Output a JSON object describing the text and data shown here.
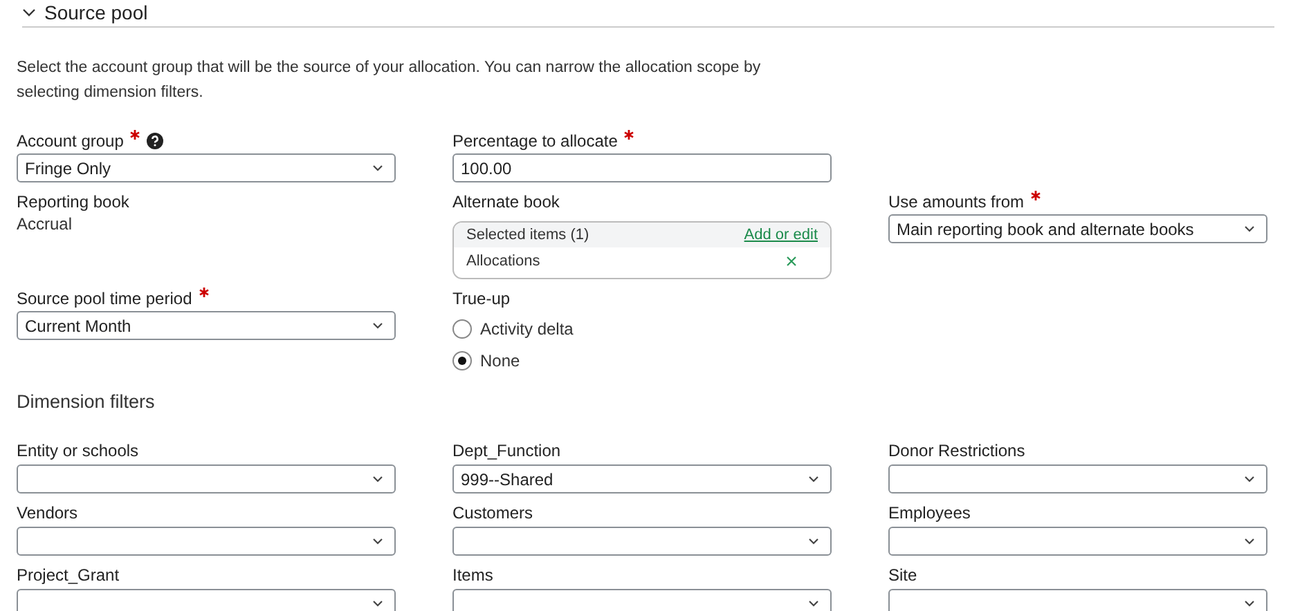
{
  "section": {
    "title": "Source pool",
    "expanded": true
  },
  "description": "Select the account group that will be the source of your allocation. You can narrow the allocation scope by selecting dimension filters.",
  "rows": [
    [
      {
        "kind": "select",
        "label": "Account group",
        "required": true,
        "help": true,
        "value": "Fringe Only"
      },
      {
        "kind": "text",
        "label": "Percentage to allocate",
        "required": true,
        "value": "100.00"
      }
    ],
    [
      {
        "kind": "readonly",
        "label": "Reporting book",
        "value": "Accrual"
      },
      {
        "kind": "multiselect",
        "label": "Alternate book",
        "header": "Selected items (1)",
        "action": "Add or edit",
        "items": [
          "Allocations"
        ]
      },
      {
        "kind": "select",
        "label": "Use amounts from",
        "required": true,
        "value": "Main reporting book and alternate books"
      }
    ],
    [
      {
        "kind": "select",
        "label": "Source pool time period",
        "required": true,
        "value": "Current Month"
      },
      {
        "kind": "radio",
        "label": "True-up",
        "options": [
          {
            "label": "Activity delta",
            "selected": false
          },
          {
            "label": "None",
            "selected": true
          }
        ]
      }
    ]
  ],
  "dimension_filters": {
    "title": "Dimension filters",
    "fields": [
      {
        "label": "Entity or schools"
      },
      {
        "label": "Dept_Function",
        "value": "999--Shared"
      },
      {
        "label": "Donor Restrictions"
      },
      {
        "label": "Vendors"
      },
      {
        "label": "Customers"
      },
      {
        "label": "Employees"
      },
      {
        "label": "Project_Grant"
      },
      {
        "label": "Items"
      },
      {
        "label": "Site"
      }
    ]
  }
}
